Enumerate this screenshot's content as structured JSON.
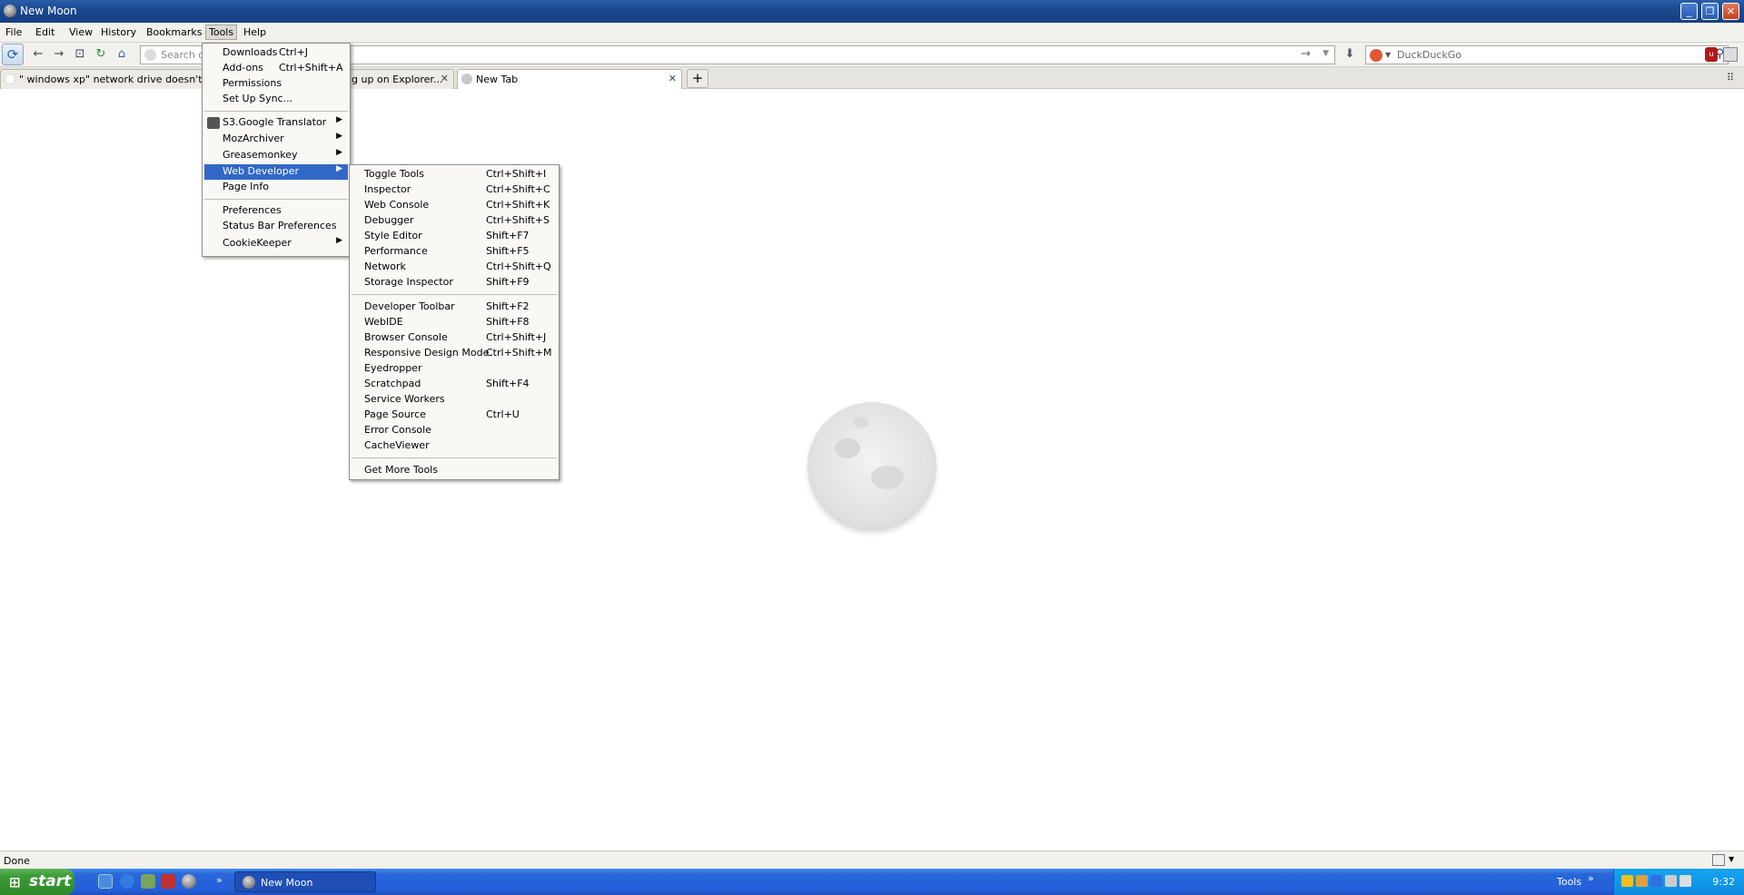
{
  "window": {
    "title": "New Moon"
  },
  "menubar": [
    "File",
    "Edit",
    "View",
    "History",
    "Bookmarks",
    "Tools",
    "Help"
  ],
  "navbar": {
    "url_placeholder": "Search o",
    "search_placeholder": "DuckDuckGo"
  },
  "tabs": [
    {
      "label": "\" windows xp\" network drive doesn't show"
    },
    {
      "label": "ing up on Explorer..."
    },
    {
      "label": "New Tab"
    }
  ],
  "tools_menu": {
    "items": [
      {
        "label": "Downloads",
        "accel": "Ctrl+J"
      },
      {
        "label": "Add-ons",
        "accel": "Ctrl+Shift+A"
      },
      {
        "label": "Permissions",
        "accel": ""
      },
      {
        "label": "Set Up Sync...",
        "accel": ""
      },
      {
        "label": "S3.Google Translator",
        "accel": ""
      },
      {
        "label": "MozArchiver",
        "accel": ""
      },
      {
        "label": "Greasemonkey",
        "accel": ""
      },
      {
        "label": "Web Developer",
        "accel": ""
      },
      {
        "label": "Page Info",
        "accel": ""
      },
      {
        "label": "Preferences",
        "accel": ""
      },
      {
        "label": "Status Bar Preferences",
        "accel": ""
      },
      {
        "label": "CookieKeeper",
        "accel": ""
      }
    ]
  },
  "webdev_menu": {
    "items": [
      {
        "label": "Toggle Tools",
        "accel": "Ctrl+Shift+I"
      },
      {
        "label": "Inspector",
        "accel": "Ctrl+Shift+C"
      },
      {
        "label": "Web Console",
        "accel": "Ctrl+Shift+K"
      },
      {
        "label": "Debugger",
        "accel": "Ctrl+Shift+S"
      },
      {
        "label": "Style Editor",
        "accel": "Shift+F7"
      },
      {
        "label": "Performance",
        "accel": "Shift+F5"
      },
      {
        "label": "Network",
        "accel": "Ctrl+Shift+Q"
      },
      {
        "label": "Storage Inspector",
        "accel": "Shift+F9"
      },
      {
        "label": "Developer Toolbar",
        "accel": "Shift+F2"
      },
      {
        "label": "WebIDE",
        "accel": "Shift+F8"
      },
      {
        "label": "Browser Console",
        "accel": "Ctrl+Shift+J"
      },
      {
        "label": "Responsive Design Mode",
        "accel": "Ctrl+Shift+M"
      },
      {
        "label": "Eyedropper",
        "accel": ""
      },
      {
        "label": "Scratchpad",
        "accel": "Shift+F4"
      },
      {
        "label": "Service Workers",
        "accel": ""
      },
      {
        "label": "Page Source",
        "accel": "Ctrl+U"
      },
      {
        "label": "Error Console",
        "accel": ""
      },
      {
        "label": "CacheViewer",
        "accel": ""
      },
      {
        "label": "Get More Tools",
        "accel": ""
      }
    ]
  },
  "statusbar": {
    "text": "Done"
  },
  "taskbar": {
    "start_label": "start",
    "task_label": "New Moon",
    "tools_label": "Tools",
    "clock": "9:32"
  }
}
